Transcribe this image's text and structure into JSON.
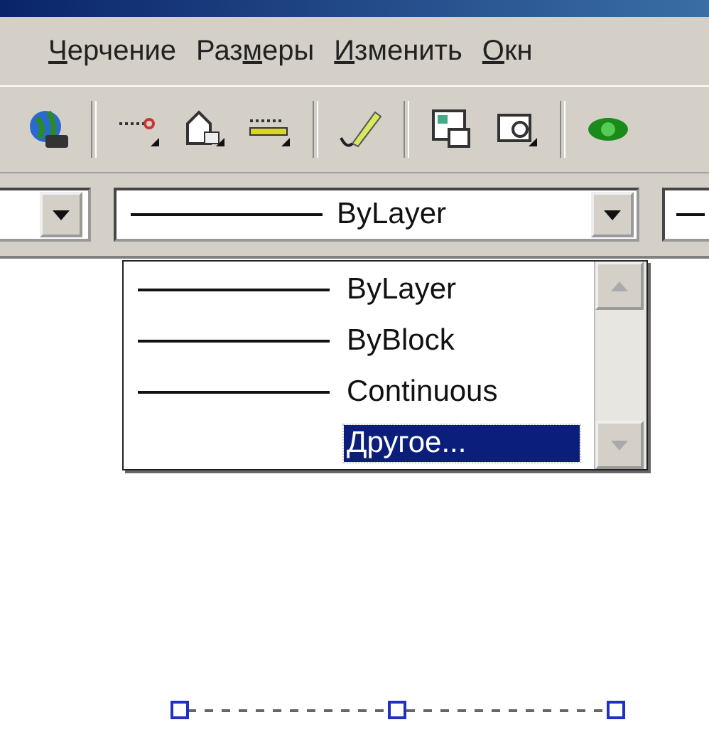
{
  "menu_bar": [
    {
      "key": "Ч",
      "rest": "ерчение"
    },
    {
      "pre": "Раз",
      "key": "м",
      "rest": "еры"
    },
    {
      "key": "И",
      "rest": "зменить"
    },
    {
      "key": "О",
      "rest": "кн"
    }
  ],
  "linetype_combo": {
    "value": "ByLayer"
  },
  "linetype_list": [
    {
      "kind": "line",
      "label": "ByLayer",
      "selected": false
    },
    {
      "kind": "line",
      "label": "ByBlock",
      "selected": false
    },
    {
      "kind": "line",
      "label": "Continuous",
      "selected": false
    },
    {
      "kind": "text",
      "label": "Другое...",
      "selected": true
    }
  ]
}
